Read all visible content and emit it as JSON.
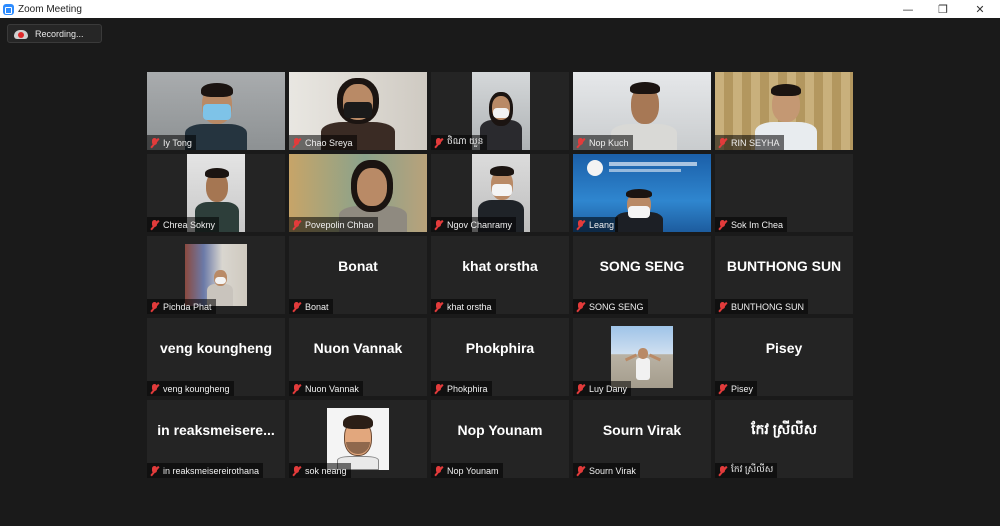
{
  "window": {
    "title": "Zoom Meeting",
    "minimize": "—",
    "restore": "❐",
    "close": "✕"
  },
  "recording": {
    "label": "Recording..."
  },
  "tiles": [
    {
      "display": "",
      "label": "Iy Tong"
    },
    {
      "display": "",
      "label": "Chao Sreya"
    },
    {
      "display": "",
      "label": "ថិណា យួន"
    },
    {
      "display": "",
      "label": "Nop Kuch"
    },
    {
      "display": "",
      "label": "RIN SEYHA"
    },
    {
      "display": "",
      "label": "Chrea Sokny"
    },
    {
      "display": "",
      "label": "Povepolin Chhao"
    },
    {
      "display": "",
      "label": "Ngov Chanramy"
    },
    {
      "display": "",
      "label": "Leang"
    },
    {
      "display": "",
      "label": "Sok Im Chea"
    },
    {
      "display": "",
      "label": "Pichda Phat"
    },
    {
      "display": "Bonat",
      "label": "Bonat"
    },
    {
      "display": "khat orstha",
      "label": "khat orstha"
    },
    {
      "display": "SONG SENG",
      "label": "SONG SENG"
    },
    {
      "display": "BUNTHONG SUN",
      "label": "BUNTHONG SUN"
    },
    {
      "display": "veng koungheng",
      "label": "veng koungheng"
    },
    {
      "display": "Nuon Vannak",
      "label": "Nuon Vannak"
    },
    {
      "display": "Phokphira",
      "label": "Phokphira"
    },
    {
      "display": "",
      "label": "Luy Dany"
    },
    {
      "display": "Pisey",
      "label": "Pisey"
    },
    {
      "display": "in  reaksmeisere...",
      "label": "in reaksmeisereirothana"
    },
    {
      "display": "",
      "label": "sok neang"
    },
    {
      "display": "Nop Younam",
      "label": "Nop Younam"
    },
    {
      "display": "Sourn Virak",
      "label": "Sourn Virak"
    },
    {
      "display": "កែវ ស្រីលីស",
      "label": "កែវ ស្រីលីស"
    }
  ]
}
